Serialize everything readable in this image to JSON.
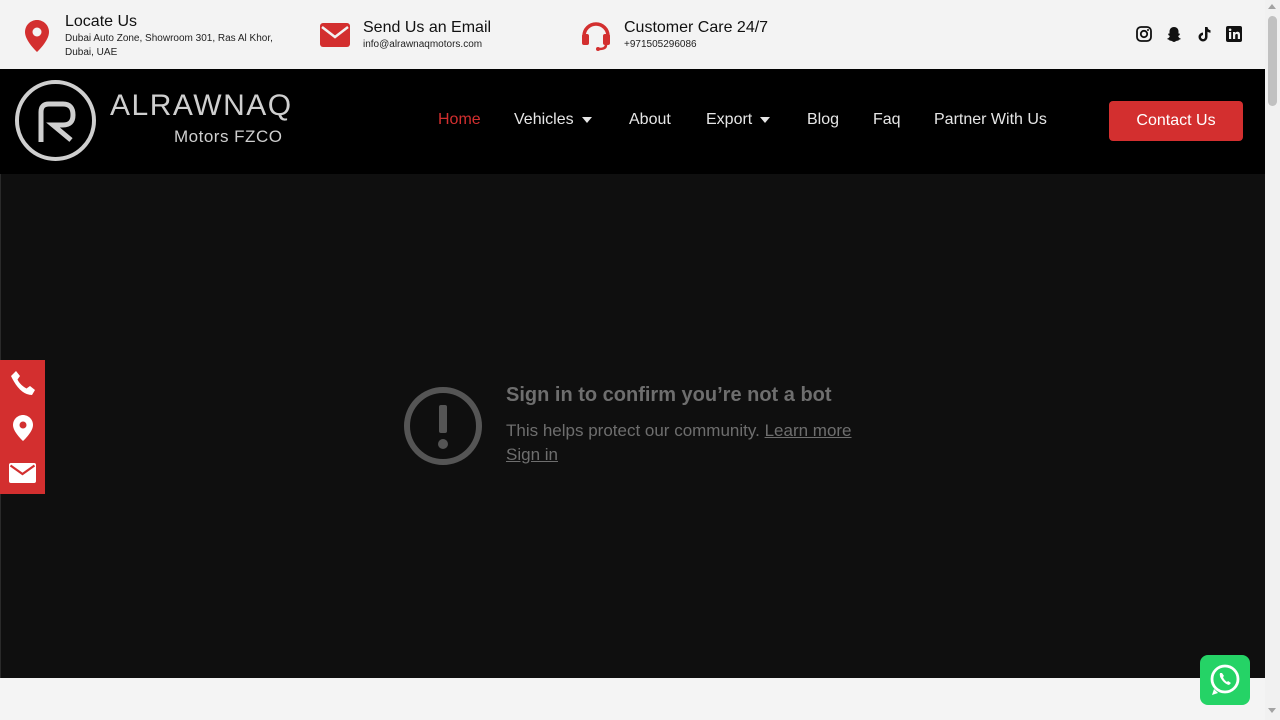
{
  "topbar": {
    "locate": {
      "title": "Locate Us",
      "line1": "Dubai Auto Zone, Showroom 301, Ras Al Khor,",
      "line2": "Dubai, UAE",
      "icon": "map-pin-icon"
    },
    "email": {
      "title": "Send Us an Email",
      "value": "info@alrawnaqmotors.com",
      "icon": "envelope-icon"
    },
    "care": {
      "title": "Customer Care 24/7",
      "value": "+971505296086",
      "icon": "headset-icon"
    },
    "social": [
      "instagram-icon",
      "snapchat-icon",
      "tiktok-icon",
      "linkedin-icon"
    ]
  },
  "brand": {
    "name": "ALRAWNAQ",
    "sub": "Motors FZCO"
  },
  "nav": {
    "items": [
      {
        "label": "Home",
        "active": true
      },
      {
        "label": "Vehicles",
        "dropdown": true
      },
      {
        "label": "About"
      },
      {
        "label": "Export",
        "dropdown": true
      },
      {
        "label": "Blog"
      },
      {
        "label": "Faq"
      },
      {
        "label": "Partner With Us"
      }
    ],
    "cta": "Contact Us"
  },
  "video": {
    "title": "Sign in to confirm you’re not a bot",
    "text": "This helps protect our community.",
    "learn_more": "Learn more",
    "sign_in": "Sign in"
  },
  "floatbar": [
    "phone-icon",
    "map-pin-icon",
    "envelope-icon"
  ],
  "colors": {
    "accent": "#d32f2f",
    "nav_bg": "#000000",
    "video_bg": "#0f0f0f",
    "whatsapp": "#25d366"
  }
}
